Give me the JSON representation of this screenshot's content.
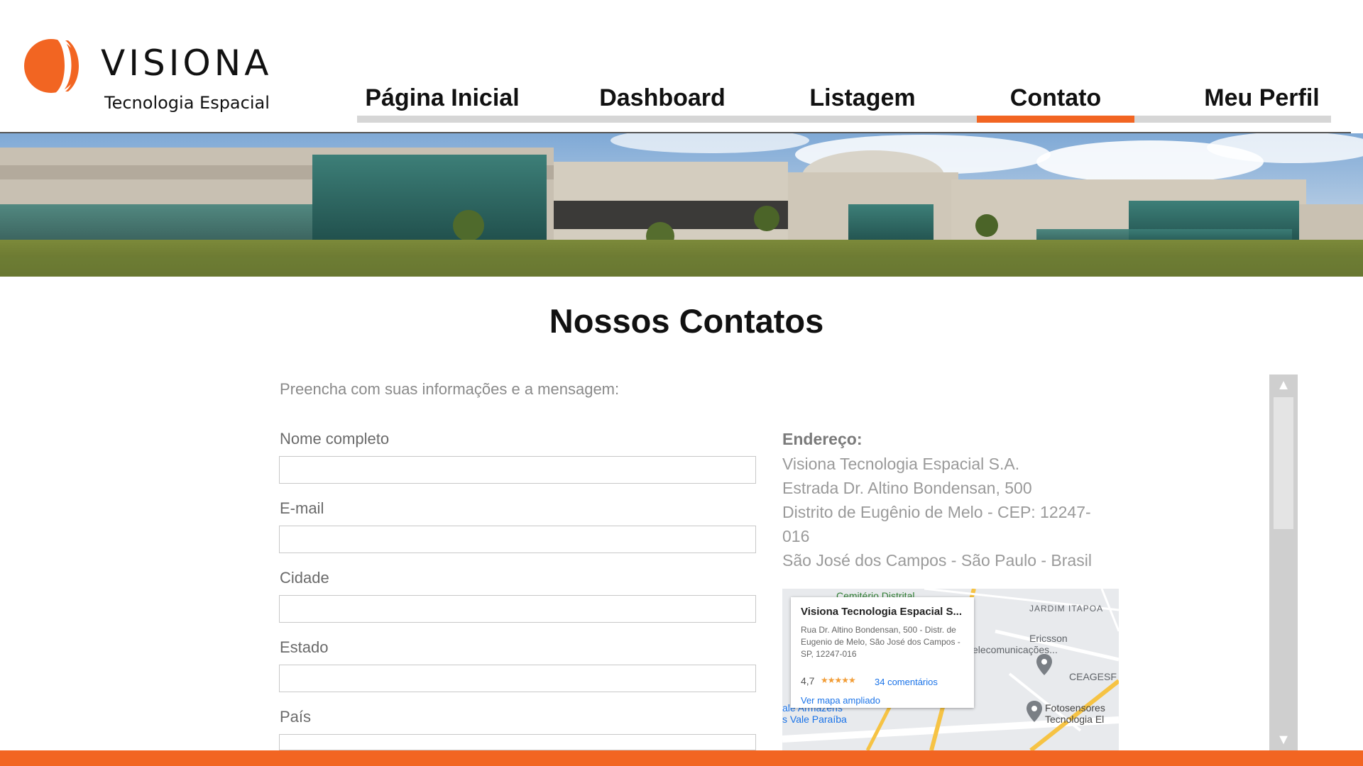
{
  "brand": {
    "name": "VISIONA",
    "tagline": "Tecnologia Espacial",
    "accent_color": "#f26522"
  },
  "nav": {
    "items": [
      {
        "label": "Página Inicial"
      },
      {
        "label": "Dashboard"
      },
      {
        "label": "Listagem"
      },
      {
        "label": "Contato",
        "active": true
      },
      {
        "label": "Meu Perfil"
      }
    ]
  },
  "page": {
    "title": "Nossos Contatos"
  },
  "form": {
    "intro": "Preencha com suas informações e a mensagem:",
    "fields": [
      {
        "label": "Nome completo",
        "value": ""
      },
      {
        "label": "E-mail",
        "value": ""
      },
      {
        "label": "Cidade",
        "value": ""
      },
      {
        "label": "Estado",
        "value": ""
      },
      {
        "label": "País",
        "value": ""
      }
    ]
  },
  "address": {
    "heading": "Endereço:",
    "lines": [
      "Visiona Tecnologia Espacial S.A.",
      "Estrada Dr. Altino Bondensan, 500",
      "Distrito de Eugênio de Melo - CEP: 12247-",
      "016",
      "São José dos Campos - São Paulo - Brasil"
    ]
  },
  "map": {
    "card_title": "Visiona Tecnologia Espacial S...",
    "card_address": "Rua Dr. Altino Bondensan, 500 - Distr. de Eugenio de Melo, São José dos Campos - SP, 12247-016",
    "rating": "4,7",
    "stars": "★★★★★",
    "reviews": "34 comentários",
    "view_larger": "Ver mapa ampliado",
    "labels": {
      "cemetery": "Cemitério Distrital",
      "neighborhood": "JARDIM ITAPOA",
      "ericsson_1": "Ericsson",
      "ericsson_2": "elecomunicações...",
      "ceagesp": "CEAGESF",
      "fotosensores_1": "Fotosensores",
      "fotosensores_2": "Tecnologia El",
      "armazens_1": "ale Armazéns",
      "armazens_2": "s Vale Paraíba"
    }
  },
  "scrollbar": {
    "up_icon": "▲",
    "down_icon": "▼"
  }
}
